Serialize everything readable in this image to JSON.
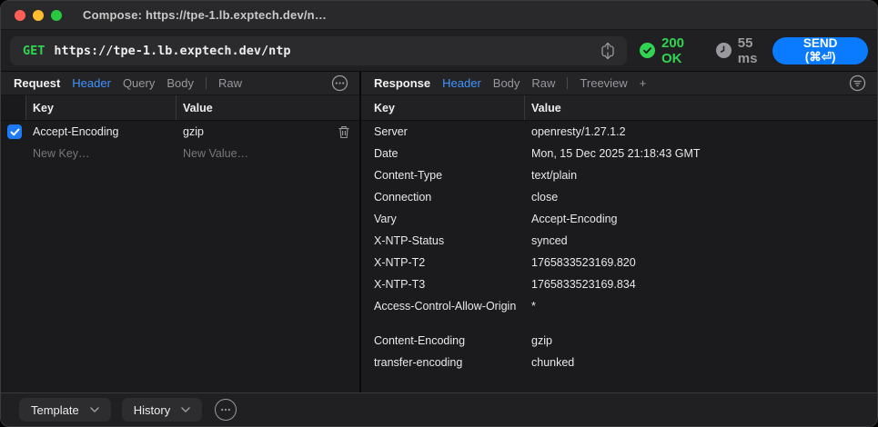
{
  "window": {
    "title": "Compose: https://tpe-1.lb.exptech.dev/n…"
  },
  "request_bar": {
    "method": "GET",
    "url": "https://tpe-1.lb.exptech.dev/ntp",
    "status_code": "200 OK",
    "latency": "55 ms",
    "send_label": "SEND (⌘⏎)"
  },
  "request_panel": {
    "title": "Request",
    "tabs": [
      {
        "label": "Header",
        "active": true
      },
      {
        "label": "Query"
      },
      {
        "label": "Body"
      },
      {
        "divider": true
      },
      {
        "label": "Raw"
      }
    ],
    "columns": {
      "key": "Key",
      "value": "Value"
    },
    "headers": [
      {
        "enabled": true,
        "key": "Accept-Encoding",
        "value": "gzip"
      }
    ],
    "new_row": {
      "key_placeholder": "New Key…",
      "value_placeholder": "New Value…"
    }
  },
  "response_panel": {
    "title": "Response",
    "tabs": [
      {
        "label": "Header",
        "active": true
      },
      {
        "label": "Body"
      },
      {
        "label": "Raw"
      },
      {
        "divider": true
      },
      {
        "label": "Treeview"
      },
      {
        "label": "+"
      }
    ],
    "columns": {
      "key": "Key",
      "value": "Value"
    },
    "headers": [
      {
        "key": "Server",
        "value": "openresty/1.27.1.2"
      },
      {
        "key": "Date",
        "value": "Mon, 15 Dec 2025 21:18:43 GMT"
      },
      {
        "key": "Content-Type",
        "value": "text/plain"
      },
      {
        "key": "Connection",
        "value": "close"
      },
      {
        "key": "Vary",
        "value": "Accept-Encoding"
      },
      {
        "key": "X-NTP-Status",
        "value": "synced"
      },
      {
        "key": "X-NTP-T2",
        "value": "1765833523169.820"
      },
      {
        "key": "X-NTP-T3",
        "value": "1765833523169.834"
      },
      {
        "key": "Access-Control-Allow-Origin",
        "value": "*"
      },
      {
        "spacer": true
      },
      {
        "key": "Content-Encoding",
        "value": "gzip"
      },
      {
        "key": "transfer-encoding",
        "value": "chunked"
      }
    ]
  },
  "bottom_bar": {
    "template_label": "Template",
    "history_label": "History"
  },
  "colors": {
    "accent_blue": "#0a7aff",
    "tab_active_blue": "#4094ff",
    "success_green": "#30d451",
    "checkbox_blue": "#1d7bf8",
    "status_gray": "#9a9a9e"
  }
}
